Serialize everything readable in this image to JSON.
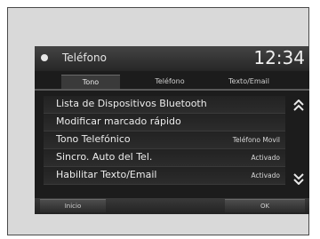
{
  "header": {
    "title": "Teléfono",
    "time": "12:34"
  },
  "tabs": [
    {
      "label": "Tono",
      "active": true
    },
    {
      "label": "Teléfono",
      "active": false
    },
    {
      "label": "Texto/Email",
      "active": false
    }
  ],
  "menu": [
    {
      "label": "Lista de Dispositivos Bluetooth",
      "value": ""
    },
    {
      "label": "Modificar marcado rápido",
      "value": ""
    },
    {
      "label": "Tono Telefónico",
      "value": "Teléfono Movil"
    },
    {
      "label": "Sincro. Auto del Tel.",
      "value": "Activado"
    },
    {
      "label": "Habilitar Texto/Email",
      "value": "Activado"
    }
  ],
  "footer": {
    "left_label": "Inicio",
    "right_label": "OK"
  },
  "colors": {
    "screen_bg": "#1c1c1c",
    "frame_bg": "#d9d9d9",
    "text": "#ececec"
  },
  "icons": {
    "scroll_up": "double-chevron-up-icon",
    "scroll_down": "double-chevron-down-icon",
    "status": "dot-icon"
  }
}
